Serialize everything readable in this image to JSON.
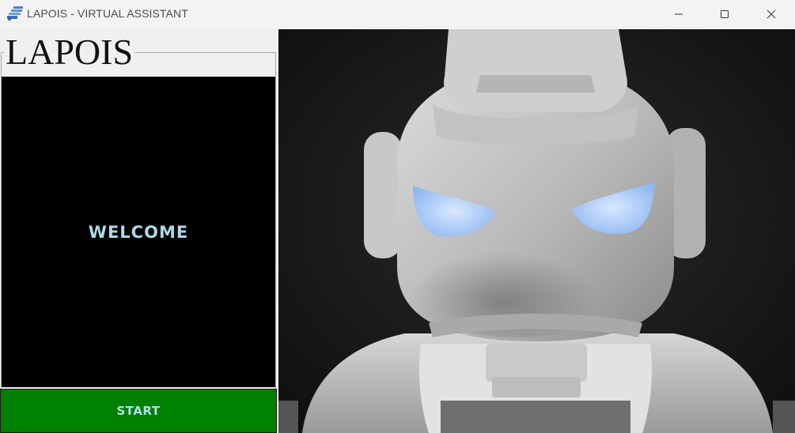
{
  "window": {
    "title": "LAPOIS - VIRTUAL ASSISTANT",
    "app_icon": "assistant-app-icon",
    "controls": {
      "minimize_icon": "minimize-icon",
      "maximize_icon": "maximize-icon",
      "close_icon": "close-icon"
    }
  },
  "panel": {
    "group_title": "LAPOIS",
    "display_text": "WELCOME",
    "display_text_color": "#add8e6",
    "start_label": "START",
    "start_color": "#008000"
  },
  "image": {
    "subject": "robot-image"
  }
}
